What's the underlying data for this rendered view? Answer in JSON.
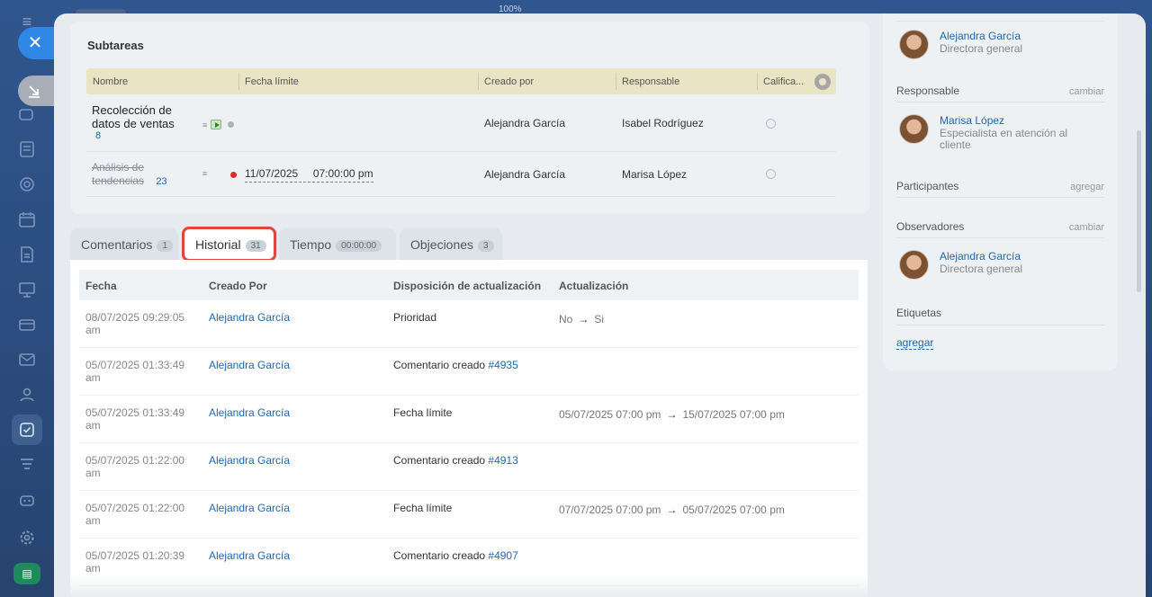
{
  "window": {
    "zoom": "100%"
  },
  "subtasks": {
    "title": "Subtareas",
    "columns": [
      "Nombre",
      "Fecha límite",
      "Creado por",
      "Responsable",
      "Califica..."
    ],
    "rows": [
      {
        "name_line1": "Recolección de",
        "name_line2": "datos de ventas",
        "count": "8",
        "deadline": "",
        "created_by": "Alejandra García",
        "responsible": "Isabel Rodríguez",
        "completed": false
      },
      {
        "name_line1": "Análisis de",
        "name_line2": "tendencias",
        "count": "23",
        "deadline_date": "11/07/2025",
        "deadline_time": "07:00:00 pm",
        "created_by": "Alejandra García",
        "responsible": "Marisa López",
        "completed": true
      }
    ]
  },
  "tabs": [
    {
      "label": "Comentarios",
      "count": "1"
    },
    {
      "label": "Historial",
      "count": "31"
    },
    {
      "label": "Tiempo",
      "count": "00:00:00"
    },
    {
      "label": "Objeciones",
      "count": "3"
    }
  ],
  "history": {
    "columns": [
      "Fecha",
      "Creado Por",
      "Disposición de actualización",
      "Actualización"
    ],
    "rows": [
      {
        "date": "08/07/2025 09:29:05",
        "ampm": "am",
        "user": "Alejandra García",
        "field": "Prioridad",
        "ref": "",
        "from": "No",
        "to": "Si"
      },
      {
        "date": "05/07/2025 01:33:49",
        "ampm": "am",
        "user": "Alejandra García",
        "field": "Comentario creado",
        "ref": "#4935",
        "from": "",
        "to": ""
      },
      {
        "date": "05/07/2025 01:33:49",
        "ampm": "am",
        "user": "Alejandra García",
        "field": "Fecha límite",
        "ref": "",
        "from": "05/07/2025 07:00 pm",
        "to": "15/07/2025 07:00 pm"
      },
      {
        "date": "05/07/2025 01:22:00",
        "ampm": "am",
        "user": "Alejandra García",
        "field": "Comentario creado",
        "ref": "#4913",
        "from": "",
        "to": ""
      },
      {
        "date": "05/07/2025 01:22:00",
        "ampm": "am",
        "user": "Alejandra García",
        "field": "Fecha límite",
        "ref": "",
        "from": "07/07/2025 07:00 pm",
        "to": "05/07/2025 07:00 pm"
      },
      {
        "date": "05/07/2025 01:20:39",
        "ampm": "am",
        "user": "Alejandra García",
        "field": "Comentario creado",
        "ref": "#4907",
        "from": "",
        "to": ""
      }
    ]
  },
  "sidebar": {
    "creator": {
      "name": "Alejandra García",
      "role": "Directora general"
    },
    "responsible": {
      "title": "Responsable",
      "action": "cambiar",
      "name": "Marisa López",
      "role": "Especialista en atención al cliente"
    },
    "participants": {
      "title": "Participantes",
      "action": "agregar"
    },
    "observers": {
      "title": "Observadores",
      "action": "cambiar",
      "name": "Alejandra García",
      "role": "Directora general"
    },
    "tags": {
      "title": "Etiquetas",
      "link": "agregar"
    }
  },
  "colors": {
    "accent": "#2067b0",
    "highlight": "#e0443c",
    "close_button": "#2f87e6"
  }
}
